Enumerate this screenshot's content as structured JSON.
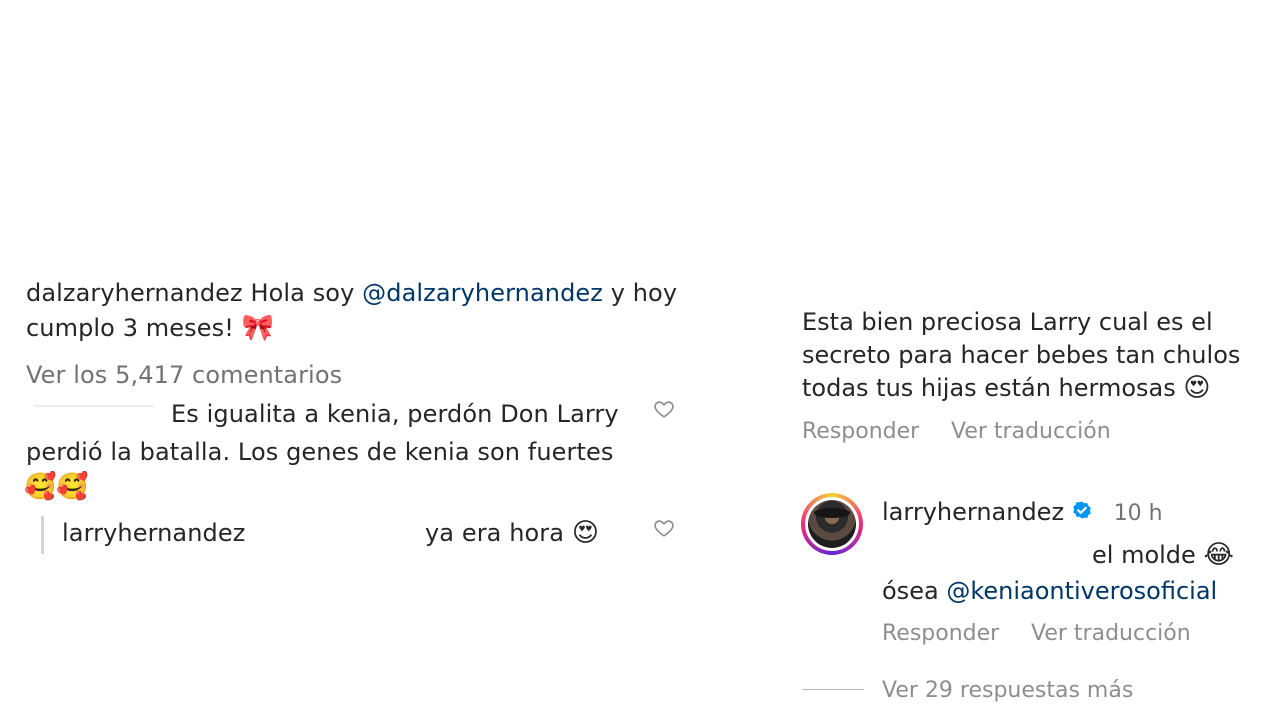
{
  "left": {
    "caption": {
      "username": "dalzaryhernandez",
      "text_before_mention": "Hola soy",
      "mention": "@dalzaryhernandez",
      "text_after_mention": "y hoy",
      "line2": "cumplo 3 meses!",
      "emoji": "🎀"
    },
    "view_comments": "Ver los 5,417 comentarios",
    "comment1": {
      "line1": "Es igualita a kenia, perdón Don Larry",
      "line2": "perdió la batalla. Los genes de kenia son fuertes",
      "emojis": "🥰🥰"
    },
    "reply1": {
      "username": "larryhernandez",
      "text": "ya era hora",
      "emoji": "😍"
    }
  },
  "right": {
    "comment": {
      "line1": "Esta bien preciosa Larry cual es el",
      "line2": "secreto para hacer bebes tan chulos",
      "line3": "todas tus hijas están hermosas",
      "emoji": "😍"
    },
    "actions": {
      "reply": "Responder",
      "translate": "Ver traducción"
    },
    "reply": {
      "username": "larryhernandez",
      "time": "10 h",
      "line1": "el molde",
      "emoji": "😂",
      "line2_prefix": "ósea",
      "mention": "@keniaontiverosoficial"
    },
    "reply_actions": {
      "reply": "Responder",
      "translate": "Ver traducción"
    },
    "more_replies": "Ver 29 respuestas más"
  },
  "colors": {
    "text": "#262626",
    "muted": "#737373",
    "mention": "#00376b",
    "verified": "#0095f6"
  },
  "icons": [
    "heart-outline-icon",
    "verified-badge-icon",
    "avatar"
  ]
}
